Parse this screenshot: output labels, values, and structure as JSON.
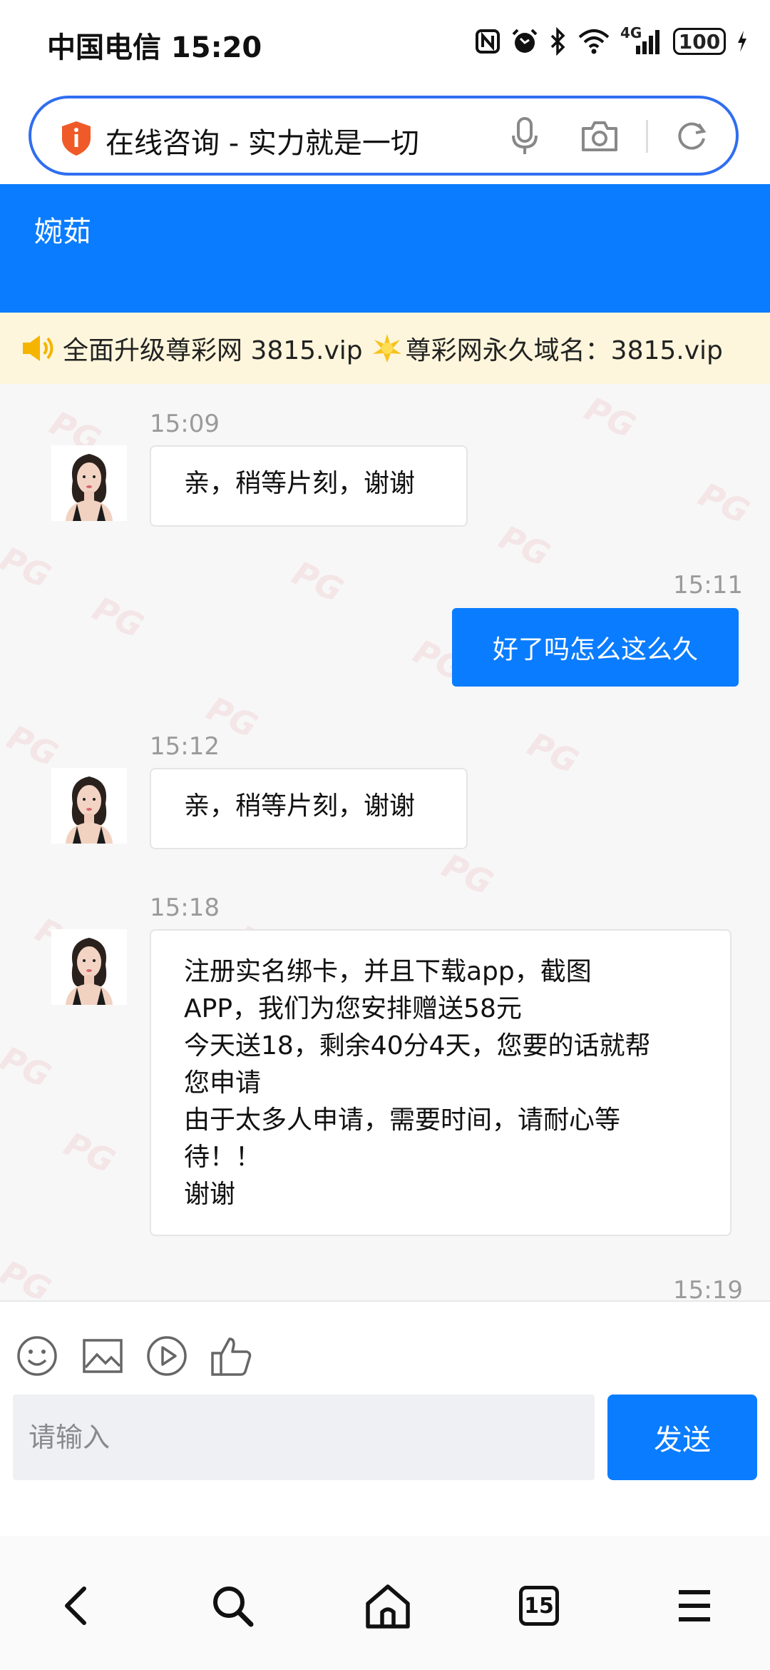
{
  "status_bar": {
    "carrier_time": "中国电信 15:20",
    "network": "4G",
    "battery": "100"
  },
  "address_bar": {
    "title": "在线咨询 - 实力就是一切"
  },
  "header": {
    "agent_name": "婉茹"
  },
  "notice": {
    "part1": "全面升级尊彩网 3815.vip",
    "part2": "尊彩网永久域名：3815.vip"
  },
  "messages": [
    {
      "time": "15:09",
      "from": "agent",
      "text": "亲，稍等片刻，谢谢"
    },
    {
      "time": "15:11",
      "from": "user",
      "text": "好了吗怎么这么久"
    },
    {
      "time": "15:12",
      "from": "agent",
      "text": "亲，稍等片刻，谢谢"
    },
    {
      "time": "15:18",
      "from": "agent",
      "lines": [
        "注册实名绑卡，并且下载app，截图",
        "APP，我们为您安排赠送58元",
        "今天送18，剩余40分4天，您要的话就帮",
        "您申请",
        "由于太多人申请，需要时间，请耐心等",
        "待！！",
        "谢谢"
      ]
    },
    {
      "time": "15:19"
    }
  ],
  "input": {
    "placeholder": "请输入",
    "send_label": "发送"
  },
  "toolbar_icons": [
    "emoji-icon",
    "image-icon",
    "video-icon",
    "thumbs-up-icon"
  ],
  "nav": {
    "tab_count": "15"
  },
  "watermark_text": "PG",
  "colors": {
    "accent": "#0a7cff",
    "address_border": "#2f6ef0",
    "notice_bg": "#fdf6dc"
  }
}
